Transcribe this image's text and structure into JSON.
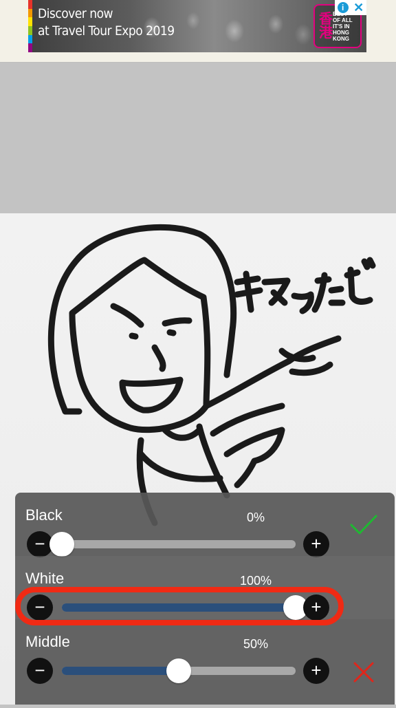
{
  "ad": {
    "headline": "Discover now\nat Travel Tour Expo 2019",
    "logo_lines": "BEST\nOF ALL\nIT'S IN\nHONG\nKONG",
    "logo_mark": "香港",
    "info_glyph": "i",
    "close_glyph": "✕",
    "stripe_colors": [
      "#e6332a",
      "#f39800",
      "#ffe100",
      "#8fc31f",
      "#00a0e9",
      "#920783"
    ]
  },
  "image": {
    "caption": "キマったぜ"
  },
  "levels": {
    "rows": [
      {
        "label": "Black",
        "value_text": "0%",
        "value": 0,
        "fill": "#2b4f7b"
      },
      {
        "label": "White",
        "value_text": "100%",
        "value": 100,
        "fill": "#2b4f7b"
      },
      {
        "label": "Middle",
        "value_text": "50%",
        "value": 50,
        "fill": "#2b4f7b"
      }
    ],
    "minus_glyph": "−",
    "plus_glyph": "+",
    "confirm_color": "#1fb832",
    "cancel_color": "#e0261b",
    "highlight_color": "#f02a14"
  }
}
